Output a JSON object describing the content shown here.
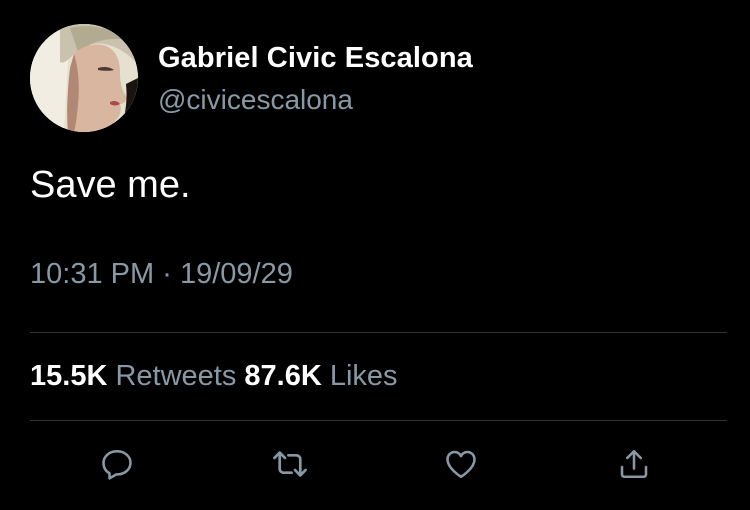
{
  "tweet": {
    "display_name": "Gabriel Civic Escalona",
    "handle": "@civicescalona",
    "text": "Save me.",
    "time": "10:31 PM",
    "separator": "·",
    "date": "19/09/29"
  },
  "stats": {
    "retweets_count": "15.5K",
    "retweets_label": "Retweets",
    "likes_count": "87.6K",
    "likes_label": "Likes"
  },
  "actions": {
    "reply_icon": "reply-icon",
    "retweet_icon": "retweet-icon",
    "like_icon": "heart-icon",
    "share_icon": "share-icon"
  },
  "colors": {
    "background": "#000000",
    "primary_text": "#ffffff",
    "secondary_text": "#8899a6",
    "divider": "#2f3336"
  }
}
